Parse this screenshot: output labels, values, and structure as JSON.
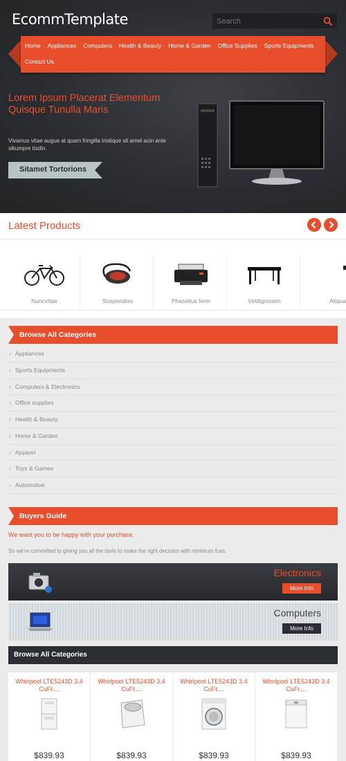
{
  "header": {
    "logo": "EcommTemplate",
    "search_placeholder": "Search"
  },
  "nav": {
    "items": [
      "Home",
      "Appliances",
      "Computers",
      "Health & Beauty",
      "Home & Garden",
      "Office Supplies",
      "Sports Equipments",
      "Contact Us"
    ]
  },
  "hero": {
    "title": "Lorem Ipsum Placerat Elementum Quisque Tunulla Maris",
    "description": "Vivamus vitae augue at quam fringilla tristique sit amet acin ante sikumpre tisdin.",
    "button": "Sitamet Tortorions"
  },
  "latest": {
    "title": "Latest Products",
    "prev_icon": "chevron-left-icon",
    "next_icon": "chevron-right-icon",
    "products": [
      {
        "label": "Nuncvitae",
        "icon": "bicycle-icon"
      },
      {
        "label": "Suspendiss",
        "icon": "massager-icon"
      },
      {
        "label": "Phasellus ferm",
        "icon": "printer-icon"
      },
      {
        "label": "Veldignissim",
        "icon": "table-icon"
      },
      {
        "label": "Aliqua",
        "icon": "product-icon"
      }
    ]
  },
  "categories": {
    "title": "Browse All Categories",
    "items": [
      "Appliances",
      "Sports Equipments",
      "Computers & Electronics",
      "Office supplies",
      "Health & Beauty",
      "Home & Garden",
      "Apparel",
      "Toys & Games",
      "Automotive"
    ]
  },
  "buyers_guide": {
    "title": "Buyers Guide",
    "line1": "We want you to be happy with your purchase.",
    "line2": "So we're committed to giving you all the tools to make the right decision with minimum fuss."
  },
  "banners": [
    {
      "title": "Electronics",
      "button": "More Info",
      "icon": "camera-icon"
    },
    {
      "title": "Computers",
      "button": "More Info",
      "icon": "laptop-icon"
    }
  ],
  "browse_bar": {
    "title": "Browse All Categories"
  },
  "washers": [
    {
      "title": "Whirlpool LTE5243D 3.4 CuFt....",
      "price": "$839.93",
      "icon": "stacked-washer-icon"
    },
    {
      "title": "Whirlpool LTE5243D 3.4 CuFt....",
      "price": "$839.93",
      "icon": "top-load-washer-icon"
    },
    {
      "title": "Whirlpool LTE5243D 3.4 CuFt....",
      "price": "$839.93",
      "icon": "front-load-washer-icon"
    },
    {
      "title": "Whirlpool LTE5243D 3.4 CuFt....",
      "price": "$839.93",
      "icon": "top-load-washer-icon"
    }
  ],
  "colors": {
    "accent": "#e84e2c",
    "dark": "#2a2d31",
    "grey_bg": "#ececec"
  }
}
